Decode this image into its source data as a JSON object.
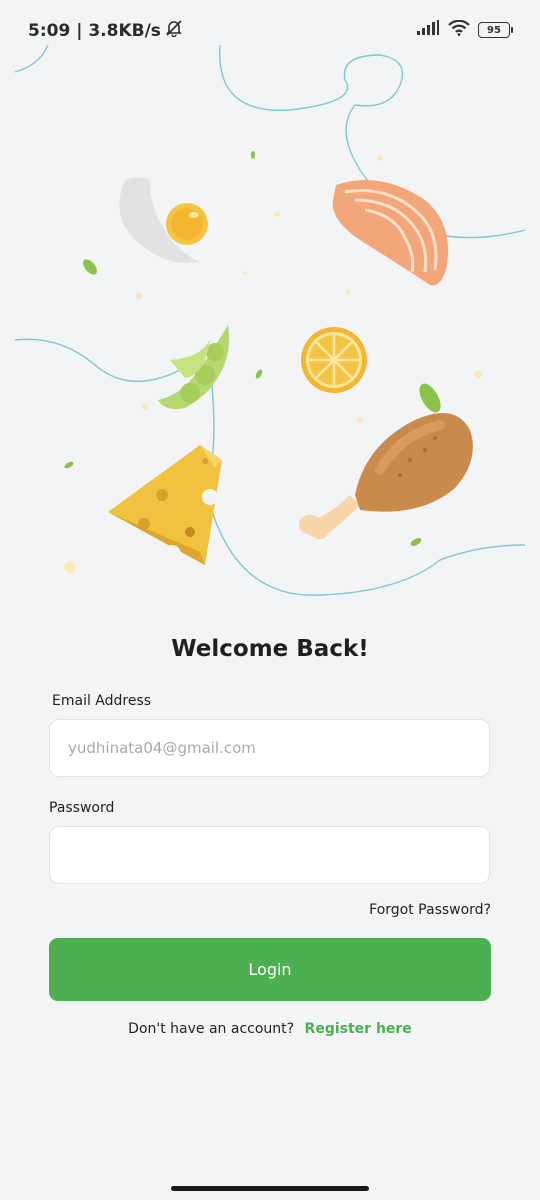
{
  "status_bar": {
    "time_speed": "5:09 | 3.8KB/s",
    "battery": "95"
  },
  "login": {
    "title": "Welcome Back!",
    "email_label": "Email Address",
    "email_placeholder": "yudhinata04@gmail.com",
    "password_label": "Password",
    "password_value": "",
    "forgot_password": "Forgot Password?",
    "login_button": "Login",
    "no_account_text": "Don't have an account?",
    "register_link": "Register here"
  },
  "colors": {
    "primary": "#4caf50",
    "background": "#f3f4f6"
  }
}
